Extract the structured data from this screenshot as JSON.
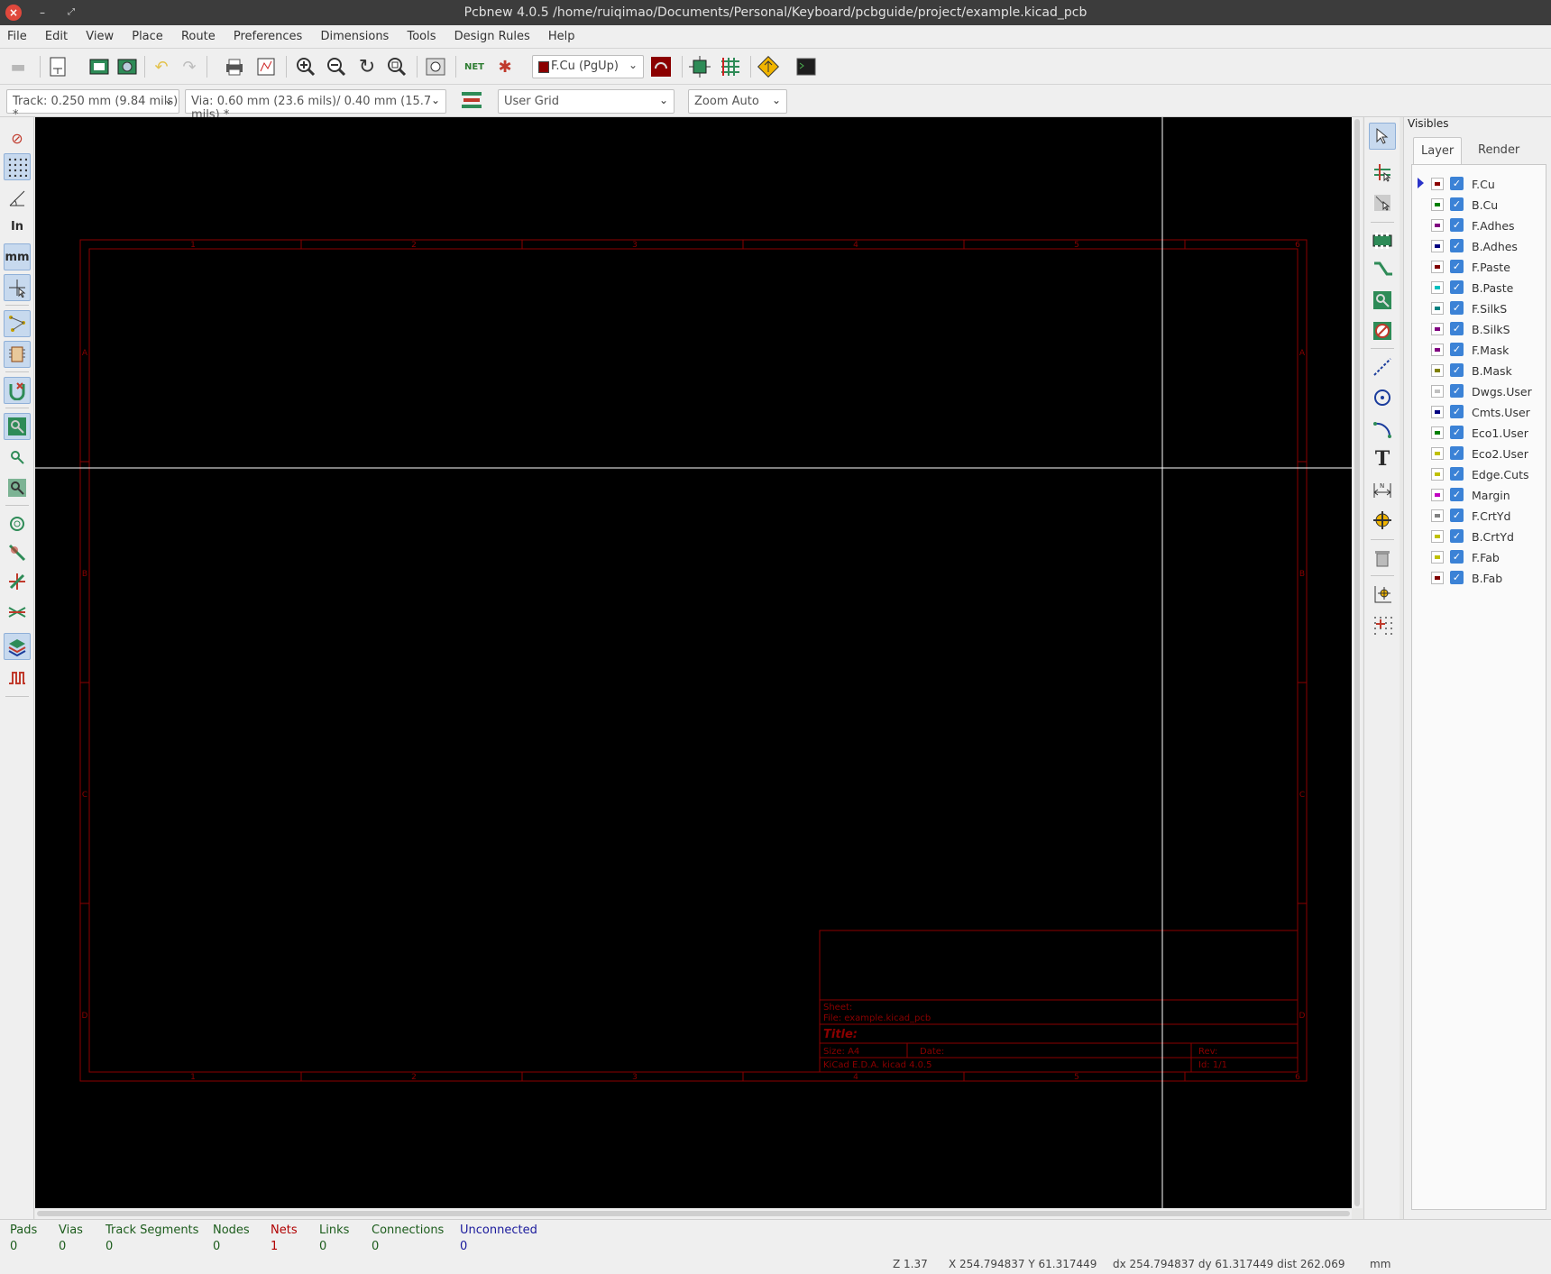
{
  "window": {
    "title": "Pcbnew 4.0.5 /home/ruiqimao/Documents/Personal/Keyboard/pcbguide/project/example.kicad_pcb"
  },
  "menu": [
    "File",
    "Edit",
    "View",
    "Place",
    "Route",
    "Preferences",
    "Dimensions",
    "Tools",
    "Design Rules",
    "Help"
  ],
  "toolbar": {
    "active_layer": "F.Cu (PgUp)",
    "net_label": "NET"
  },
  "toolbar2": {
    "track": "Track: 0.250 mm (9.84 mils) *",
    "via": "Via: 0.60 mm (23.6 mils)/ 0.40 mm (15.7 mils) *",
    "grid": "User Grid",
    "zoom": "Zoom Auto"
  },
  "left_toolbar": {
    "units_in": "In",
    "units_mm": "mm"
  },
  "right_toolbar": {
    "text_tool": "T"
  },
  "drawing": {
    "col_marks": [
      "1",
      "2",
      "3",
      "4",
      "5",
      "6"
    ],
    "row_marks": [
      "A",
      "B",
      "C",
      "D"
    ],
    "title_block": {
      "sheet": "Sheet:",
      "file": "File: example.kicad_pcb",
      "title": "Title:",
      "size": "Size: A4",
      "date": "Date:",
      "rev": "Rev:",
      "tool": "KiCad E.D.A.  kicad 4.0.5",
      "id": "Id: 1/1"
    }
  },
  "visibles": {
    "header": "Visibles",
    "tabs": [
      "Layer",
      "Render"
    ],
    "layers": [
      {
        "name": "F.Cu",
        "color": "#8b0000",
        "active": true
      },
      {
        "name": "B.Cu",
        "color": "#008000"
      },
      {
        "name": "F.Adhes",
        "color": "#800080"
      },
      {
        "name": "B.Adhes",
        "color": "#000080"
      },
      {
        "name": "F.Paste",
        "color": "#800000"
      },
      {
        "name": "B.Paste",
        "color": "#00c0c0"
      },
      {
        "name": "F.SilkS",
        "color": "#008080"
      },
      {
        "name": "B.SilkS",
        "color": "#800080"
      },
      {
        "name": "F.Mask",
        "color": "#800080"
      },
      {
        "name": "B.Mask",
        "color": "#808000"
      },
      {
        "name": "Dwgs.User",
        "color": "#c0c0c0"
      },
      {
        "name": "Cmts.User",
        "color": "#000080"
      },
      {
        "name": "Eco1.User",
        "color": "#008000"
      },
      {
        "name": "Eco2.User",
        "color": "#c0c000"
      },
      {
        "name": "Edge.Cuts",
        "color": "#c0c000"
      },
      {
        "name": "Margin",
        "color": "#c000c0"
      },
      {
        "name": "F.CrtYd",
        "color": "#808080"
      },
      {
        "name": "B.CrtYd",
        "color": "#c0c000"
      },
      {
        "name": "F.Fab",
        "color": "#c0c000"
      },
      {
        "name": "B.Fab",
        "color": "#800000"
      }
    ]
  },
  "status": {
    "items": [
      {
        "label": "Pads",
        "value": "0",
        "color": "#1c5c1c"
      },
      {
        "label": "Vias",
        "value": "0",
        "color": "#1c5c1c"
      },
      {
        "label": "Track Segments",
        "value": "0",
        "color": "#1c5c1c"
      },
      {
        "label": "Nodes",
        "value": "0",
        "color": "#1c5c1c"
      },
      {
        "label": "Nets",
        "value": "1",
        "color": "#b00000"
      },
      {
        "label": "Links",
        "value": "0",
        "color": "#1c5c1c"
      },
      {
        "label": "Connections",
        "value": "0",
        "color": "#1c5c1c"
      },
      {
        "label": "Unconnected",
        "value": "0",
        "color": "#1a1a9c"
      }
    ],
    "zoom": "Z 1.37",
    "xy": "X 254.794837  Y 61.317449",
    "delta": "dx 254.794837  dy 61.317449  dist 262.069",
    "units": "mm"
  },
  "colors": {
    "canvas": "#000000",
    "sheet_frame": "#8b0000",
    "cursor": "#ffffff",
    "accent": "#3b82d6"
  }
}
